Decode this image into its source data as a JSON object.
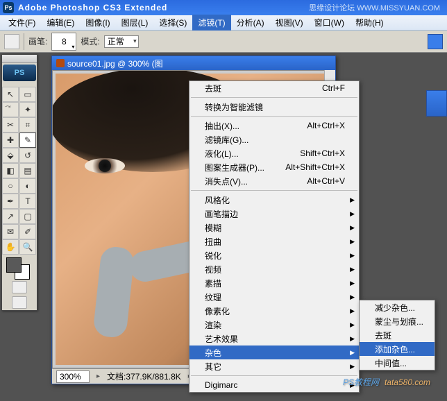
{
  "titlebar": {
    "app_icon_text": "Ps",
    "title": "Adobe Photoshop CS3 Extended",
    "watermark": "思缘设计论坛  WWW.MISSYUAN.COM"
  },
  "menubar": {
    "items": [
      "文件(F)",
      "编辑(E)",
      "图像(I)",
      "图层(L)",
      "选择(S)",
      "滤镜(T)",
      "分析(A)",
      "视图(V)",
      "窗口(W)",
      "帮助(H)"
    ],
    "active_index": 5
  },
  "optionsbar": {
    "brush_label": "画笔:",
    "brush_size": "8",
    "mode_label": "模式:",
    "mode_value": "正常"
  },
  "toolpalette": {
    "ps_label": "PS",
    "tools": [
      {
        "name": "move-tool",
        "glyph": "↖"
      },
      {
        "name": "marquee-tool",
        "glyph": "▭"
      },
      {
        "name": "lasso-tool",
        "glyph": "⃕"
      },
      {
        "name": "wand-tool",
        "glyph": "✦"
      },
      {
        "name": "crop-tool",
        "glyph": "✂"
      },
      {
        "name": "slice-tool",
        "glyph": "⌗"
      },
      {
        "name": "heal-tool",
        "glyph": "✚"
      },
      {
        "name": "brush-tool",
        "glyph": "✎"
      },
      {
        "name": "stamp-tool",
        "glyph": "⬙"
      },
      {
        "name": "history-brush-tool",
        "glyph": "↺"
      },
      {
        "name": "eraser-tool",
        "glyph": "◧"
      },
      {
        "name": "gradient-tool",
        "glyph": "▤"
      },
      {
        "name": "blur-tool",
        "glyph": "○"
      },
      {
        "name": "dodge-tool",
        "glyph": "◐"
      },
      {
        "name": "pen-tool",
        "glyph": "✒"
      },
      {
        "name": "type-tool",
        "glyph": "T"
      },
      {
        "name": "path-tool",
        "glyph": "↗"
      },
      {
        "name": "shape-tool",
        "glyph": "▢"
      },
      {
        "name": "notes-tool",
        "glyph": "✉"
      },
      {
        "name": "eyedropper-tool",
        "glyph": "✐"
      },
      {
        "name": "hand-tool",
        "glyph": "✋"
      },
      {
        "name": "zoom-tool",
        "glyph": "🔍"
      }
    ],
    "selected_index": 7,
    "fg_color": "#595959",
    "bg_color": "#ffffff"
  },
  "document": {
    "title": "source01.jpg @ 300% (图",
    "zoom": "300%",
    "filesize_label": "文档:377.9K/881.8K"
  },
  "filter_menu": {
    "top": [
      {
        "label": "去斑",
        "shortcut": "Ctrl+F"
      }
    ],
    "convert": {
      "label": "转换为智能滤镜"
    },
    "group2": [
      {
        "label": "抽出(X)...",
        "shortcut": "Alt+Ctrl+X"
      },
      {
        "label": "滤镜库(G)...",
        "shortcut": ""
      },
      {
        "label": "液化(L)...",
        "shortcut": "Shift+Ctrl+X"
      },
      {
        "label": "图案生成器(P)...",
        "shortcut": "Alt+Shift+Ctrl+X"
      },
      {
        "label": "消失点(V)...",
        "shortcut": "Alt+Ctrl+V"
      }
    ],
    "group3": [
      {
        "label": "风格化",
        "submenu": true
      },
      {
        "label": "画笔描边",
        "submenu": true
      },
      {
        "label": "模糊",
        "submenu": true
      },
      {
        "label": "扭曲",
        "submenu": true
      },
      {
        "label": "锐化",
        "submenu": true
      },
      {
        "label": "视频",
        "submenu": true
      },
      {
        "label": "素描",
        "submenu": true
      },
      {
        "label": "纹理",
        "submenu": true
      },
      {
        "label": "像素化",
        "submenu": true
      },
      {
        "label": "渲染",
        "submenu": true
      },
      {
        "label": "艺术效果",
        "submenu": true
      },
      {
        "label": "杂色",
        "submenu": true,
        "highlight": true
      },
      {
        "label": "其它",
        "submenu": true
      }
    ],
    "group4": [
      {
        "label": "Digimarc",
        "submenu": true
      }
    ]
  },
  "noise_submenu": {
    "items": [
      {
        "label": "减少杂色..."
      },
      {
        "label": "蒙尘与划痕..."
      },
      {
        "label": "去斑"
      },
      {
        "label": "添加杂色...",
        "highlight": true
      },
      {
        "label": "中间值..."
      }
    ]
  },
  "bottom_watermark": {
    "w1": "PS教程网",
    "w2": "tata580.com"
  }
}
